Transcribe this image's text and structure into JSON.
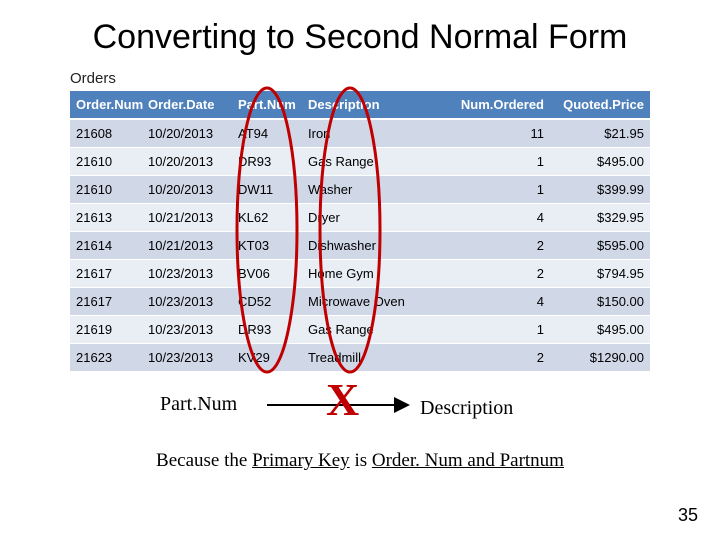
{
  "title": "Converting to Second Normal Form",
  "table": {
    "caption": "Orders",
    "headers": [
      "Order.Num",
      "Order.Date",
      "Part.Num",
      "Description",
      "Num.Ordered",
      "Quoted.Price"
    ],
    "rows": [
      [
        "21608",
        "10/20/2013",
        "AT94",
        "Iron",
        "11",
        "$21.95"
      ],
      [
        "21610",
        "10/20/2013",
        "DR93",
        "Gas Range",
        "1",
        "$495.00"
      ],
      [
        "21610",
        "10/20/2013",
        "DW11",
        "Washer",
        "1",
        "$399.99"
      ],
      [
        "21613",
        "10/21/2013",
        "KL62",
        "Dryer",
        "4",
        "$329.95"
      ],
      [
        "21614",
        "10/21/2013",
        "KT03",
        "Dishwasher",
        "2",
        "$595.00"
      ],
      [
        "21617",
        "10/23/2013",
        "BV06",
        "Home Gym",
        "2",
        "$794.95"
      ],
      [
        "21617",
        "10/23/2013",
        "CD52",
        "Microwave Oven",
        "4",
        "$150.00"
      ],
      [
        "21619",
        "10/23/2013",
        "DR93",
        "Gas Range",
        "1",
        "$495.00"
      ],
      [
        "21623",
        "10/23/2013",
        "KV29",
        "Treadmill",
        "2",
        "$1290.00"
      ]
    ]
  },
  "annot": {
    "left_label": "Part.Num",
    "right_label": "Description",
    "x_mark": "X"
  },
  "because": {
    "prefix": "Because the ",
    "ul1": "Primary Key",
    "mid": " is ",
    "ul2": "Order. Num and Partnum"
  },
  "page_number": "35",
  "colors": {
    "oval_stroke": "#c00000",
    "arrow": "#000000"
  }
}
